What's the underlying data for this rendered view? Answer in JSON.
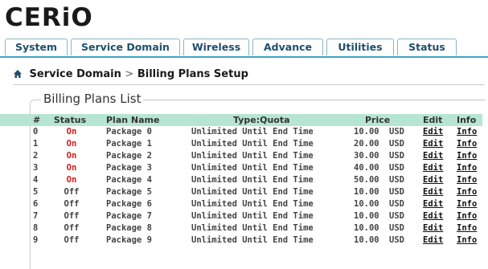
{
  "brand": {
    "logo_text": "CERiO"
  },
  "tabs": [
    {
      "label": "System"
    },
    {
      "label": "Service Domain"
    },
    {
      "label": "Wireless"
    },
    {
      "label": "Advance"
    },
    {
      "label": "Utilities"
    },
    {
      "label": "Status"
    }
  ],
  "breadcrumb": {
    "section": "Service Domain",
    "separator": ">",
    "page": "Billing Plans Setup"
  },
  "billing_list": {
    "legend": "Billing Plans List",
    "columns": {
      "num": "#",
      "status": "Status",
      "plan": "Plan Name",
      "type": "Type:Quota",
      "price": "Price",
      "edit": "Edit",
      "info": "Info"
    },
    "rows": [
      {
        "num": "0",
        "status": "On",
        "plan": "Package 0",
        "type": "Unlimited Until End Time",
        "price": "10.00",
        "currency": "USD",
        "edit": "Edit",
        "info": "Info"
      },
      {
        "num": "1",
        "status": "On",
        "plan": "Package 1",
        "type": "Unlimited Until End Time",
        "price": "20.00",
        "currency": "USD",
        "edit": "Edit",
        "info": "Info"
      },
      {
        "num": "2",
        "status": "On",
        "plan": "Package 2",
        "type": "Unlimited Until End Time",
        "price": "30.00",
        "currency": "USD",
        "edit": "Edit",
        "info": "Info"
      },
      {
        "num": "3",
        "status": "On",
        "plan": "Package 3",
        "type": "Unlimited Until End Time",
        "price": "40.00",
        "currency": "USD",
        "edit": "Edit",
        "info": "Info"
      },
      {
        "num": "4",
        "status": "On",
        "plan": "Package 4",
        "type": "Unlimited Until End Time",
        "price": "50.00",
        "currency": "USD",
        "edit": "Edit",
        "info": "Info"
      },
      {
        "num": "5",
        "status": "Off",
        "plan": "Package 5",
        "type": "Unlimited Until End Time",
        "price": "10.00",
        "currency": "USD",
        "edit": "Edit",
        "info": "Info"
      },
      {
        "num": "6",
        "status": "Off",
        "plan": "Package 6",
        "type": "Unlimited Until End Time",
        "price": "10.00",
        "currency": "USD",
        "edit": "Edit",
        "info": "Info"
      },
      {
        "num": "7",
        "status": "Off",
        "plan": "Package 7",
        "type": "Unlimited Until End Time",
        "price": "10.00",
        "currency": "USD",
        "edit": "Edit",
        "info": "Info"
      },
      {
        "num": "8",
        "status": "Off",
        "plan": "Package 8",
        "type": "Unlimited Until End Time",
        "price": "10.00",
        "currency": "USD",
        "edit": "Edit",
        "info": "Info"
      },
      {
        "num": "9",
        "status": "Off",
        "plan": "Package 9",
        "type": "Unlimited Until End Time",
        "price": "10.00",
        "currency": "USD",
        "edit": "Edit",
        "info": "Info"
      }
    ]
  },
  "colors": {
    "accent": "#3da2c4",
    "header_row": "#b7e5d3",
    "status_on": "#d61a1a"
  },
  "icons": {
    "breadcrumb": "home-icon"
  }
}
